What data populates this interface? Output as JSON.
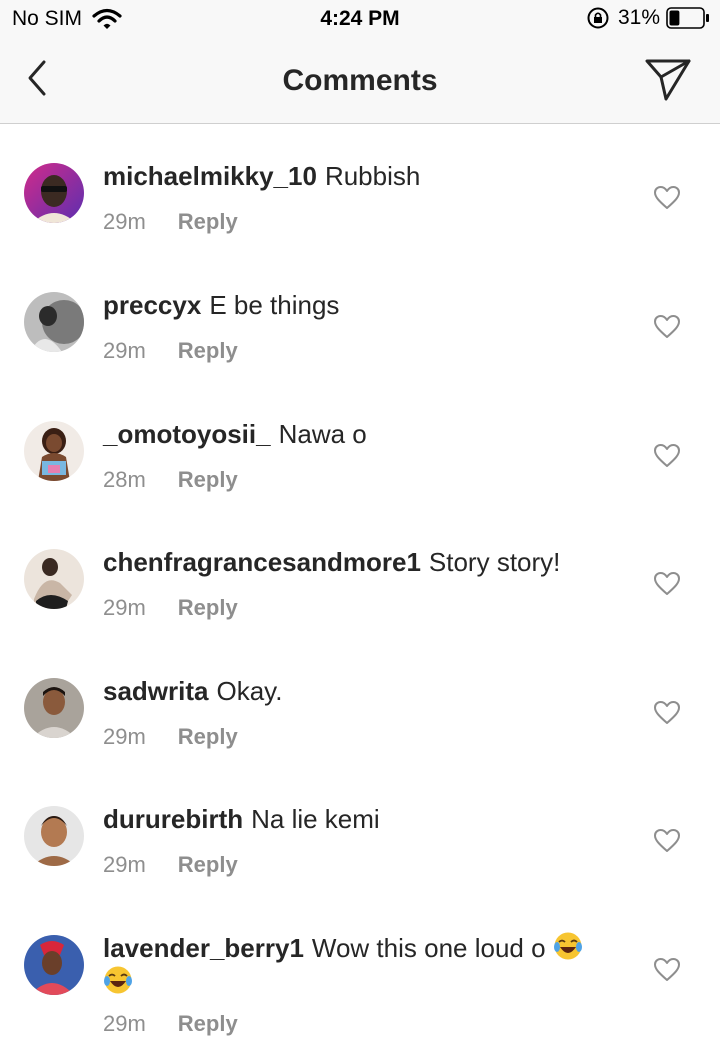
{
  "status_bar": {
    "carrier": "No SIM",
    "time": "4:24 PM",
    "battery": "31%",
    "battery_level": 0.31
  },
  "nav": {
    "title": "Comments",
    "back_icon": "chevron-left-icon",
    "send_icon": "paper-plane-icon"
  },
  "comments": [
    {
      "username": "michaelmikky_10",
      "text": "Rubbish",
      "time": "29m",
      "reply": "Reply"
    },
    {
      "username": "preccyx",
      "text": "E be things",
      "time": "29m",
      "reply": "Reply"
    },
    {
      "username": "_omotoyosii_",
      "text": "Nawa o",
      "time": "28m",
      "reply": "Reply"
    },
    {
      "username": "chenfragrancesandmore1",
      "text": "Story story!",
      "time": "29m",
      "reply": "Reply"
    },
    {
      "username": "sadwrita",
      "text": "Okay.",
      "time": "29m",
      "reply": "Reply"
    },
    {
      "username": "dururebirth",
      "text": "Na lie kemi",
      "time": "29m",
      "reply": "Reply"
    },
    {
      "username": "lavender_berry1",
      "text": "Wow this one loud o",
      "time": "29m",
      "reply": "Reply",
      "emojis": [
        "laughing-tears-emoji",
        "laughing-tears-emoji"
      ]
    }
  ]
}
